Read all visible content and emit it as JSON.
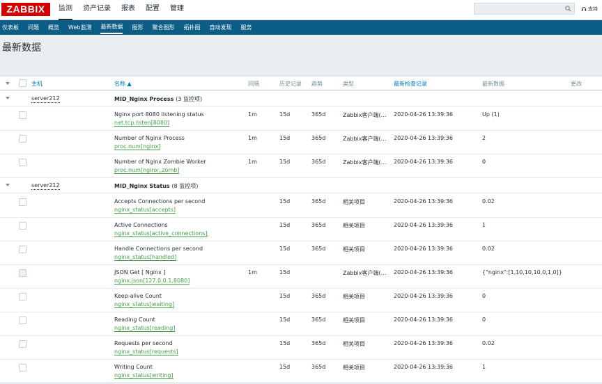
{
  "logo": "ZABBIX",
  "top_menu": [
    {
      "label": "监测",
      "active": true
    },
    {
      "label": "资产记录",
      "active": false
    },
    {
      "label": "报表",
      "active": false
    },
    {
      "label": "配置",
      "active": false
    },
    {
      "label": "管理",
      "active": false
    }
  ],
  "search": {
    "placeholder": ""
  },
  "support_label": "支持",
  "sub_menu": [
    {
      "label": "仪表板",
      "active": false
    },
    {
      "label": "问题",
      "active": false
    },
    {
      "label": "概览",
      "active": false
    },
    {
      "label": "Web监测",
      "active": false
    },
    {
      "label": "最新数据",
      "active": true
    },
    {
      "label": "图形",
      "active": false
    },
    {
      "label": "聚合图形",
      "active": false
    },
    {
      "label": "拓扑图",
      "active": false
    },
    {
      "label": "自动发现",
      "active": false
    },
    {
      "label": "服务",
      "active": false
    }
  ],
  "page_title": "最新数据",
  "table": {
    "headers": {
      "host": "主机",
      "name": "名称 ▲",
      "interval": "间隔",
      "history": "历史记录",
      "trends": "趋势",
      "type": "类型",
      "last_check": "最新检查记录",
      "last_value": "最新数据",
      "change": "更改"
    },
    "groups": [
      {
        "host": "server212",
        "app": "MID_Nginx Process",
        "count": "(3 监控项)",
        "items": [
          {
            "name": "Nginx port 8080 listening status",
            "key": "net.tcp.listen[8080]",
            "interval": "1m",
            "history": "15d",
            "trends": "365d",
            "type": "Zabbix客户端(…",
            "last_check": "2020-04-26 13:39:36",
            "value": "Up (1)",
            "disabled": false
          },
          {
            "name": "Number of Nginx Process",
            "key": "proc.num[nginx]",
            "interval": "1m",
            "history": "15d",
            "trends": "365d",
            "type": "Zabbix客户端(…",
            "last_check": "2020-04-26 13:39:36",
            "value": "2",
            "disabled": false
          },
          {
            "name": "Number of Nginx Zombie Worker",
            "key": "proc.num[nginx,,zomb]",
            "interval": "1m",
            "history": "15d",
            "trends": "365d",
            "type": "Zabbix客户端(…",
            "last_check": "2020-04-26 13:39:36",
            "value": "0",
            "disabled": false
          }
        ]
      },
      {
        "host": "server212",
        "app": "MID_Nginx Status",
        "count": "(8 监控项)",
        "items": [
          {
            "name": "Accepts Connections per second",
            "key": "nginx_status[accepts]",
            "interval": "",
            "history": "15d",
            "trends": "365d",
            "type": "相关项目",
            "last_check": "2020-04-26 13:39:36",
            "value": "0.02",
            "disabled": false
          },
          {
            "name": "Active Connections",
            "key": "nginx_status[active_connections]",
            "interval": "",
            "history": "15d",
            "trends": "365d",
            "type": "相关项目",
            "last_check": "2020-04-26 13:39:36",
            "value": "1",
            "disabled": false
          },
          {
            "name": "Handle Connections per second",
            "key": "nginx_status[handled]",
            "interval": "",
            "history": "15d",
            "trends": "365d",
            "type": "相关项目",
            "last_check": "2020-04-26 13:39:36",
            "value": "0.02",
            "disabled": false
          },
          {
            "name": "JSON Get [ Nginx ]",
            "key": "nginx.json[127.0.0.1,8080]",
            "interval": "1m",
            "history": "15d",
            "trends": "",
            "type": "Zabbix客户端(…",
            "last_check": "2020-04-26 13:39:36",
            "value": "{\"nginx\":[1,10,10,10,0,1,0]}",
            "disabled": true
          },
          {
            "name": "Keep-alive Count",
            "key": "nginx_status[waiting]",
            "interval": "",
            "history": "15d",
            "trends": "365d",
            "type": "相关项目",
            "last_check": "2020-04-26 13:39:36",
            "value": "0",
            "disabled": false
          },
          {
            "name": "Reading Count",
            "key": "nginx_status[reading]",
            "interval": "",
            "history": "15d",
            "trends": "365d",
            "type": "相关项目",
            "last_check": "2020-04-26 13:39:36",
            "value": "0",
            "disabled": false
          },
          {
            "name": "Requests per second",
            "key": "nginx_status[requests]",
            "interval": "",
            "history": "15d",
            "trends": "365d",
            "type": "相关项目",
            "last_check": "2020-04-26 13:39:36",
            "value": "0.02",
            "disabled": false
          },
          {
            "name": "Writing Count",
            "key": "nginx_status[writing]",
            "interval": "",
            "history": "15d",
            "trends": "365d",
            "type": "相关项目",
            "last_check": "2020-04-26 13:39:36",
            "value": "1",
            "disabled": false
          }
        ]
      }
    ]
  }
}
